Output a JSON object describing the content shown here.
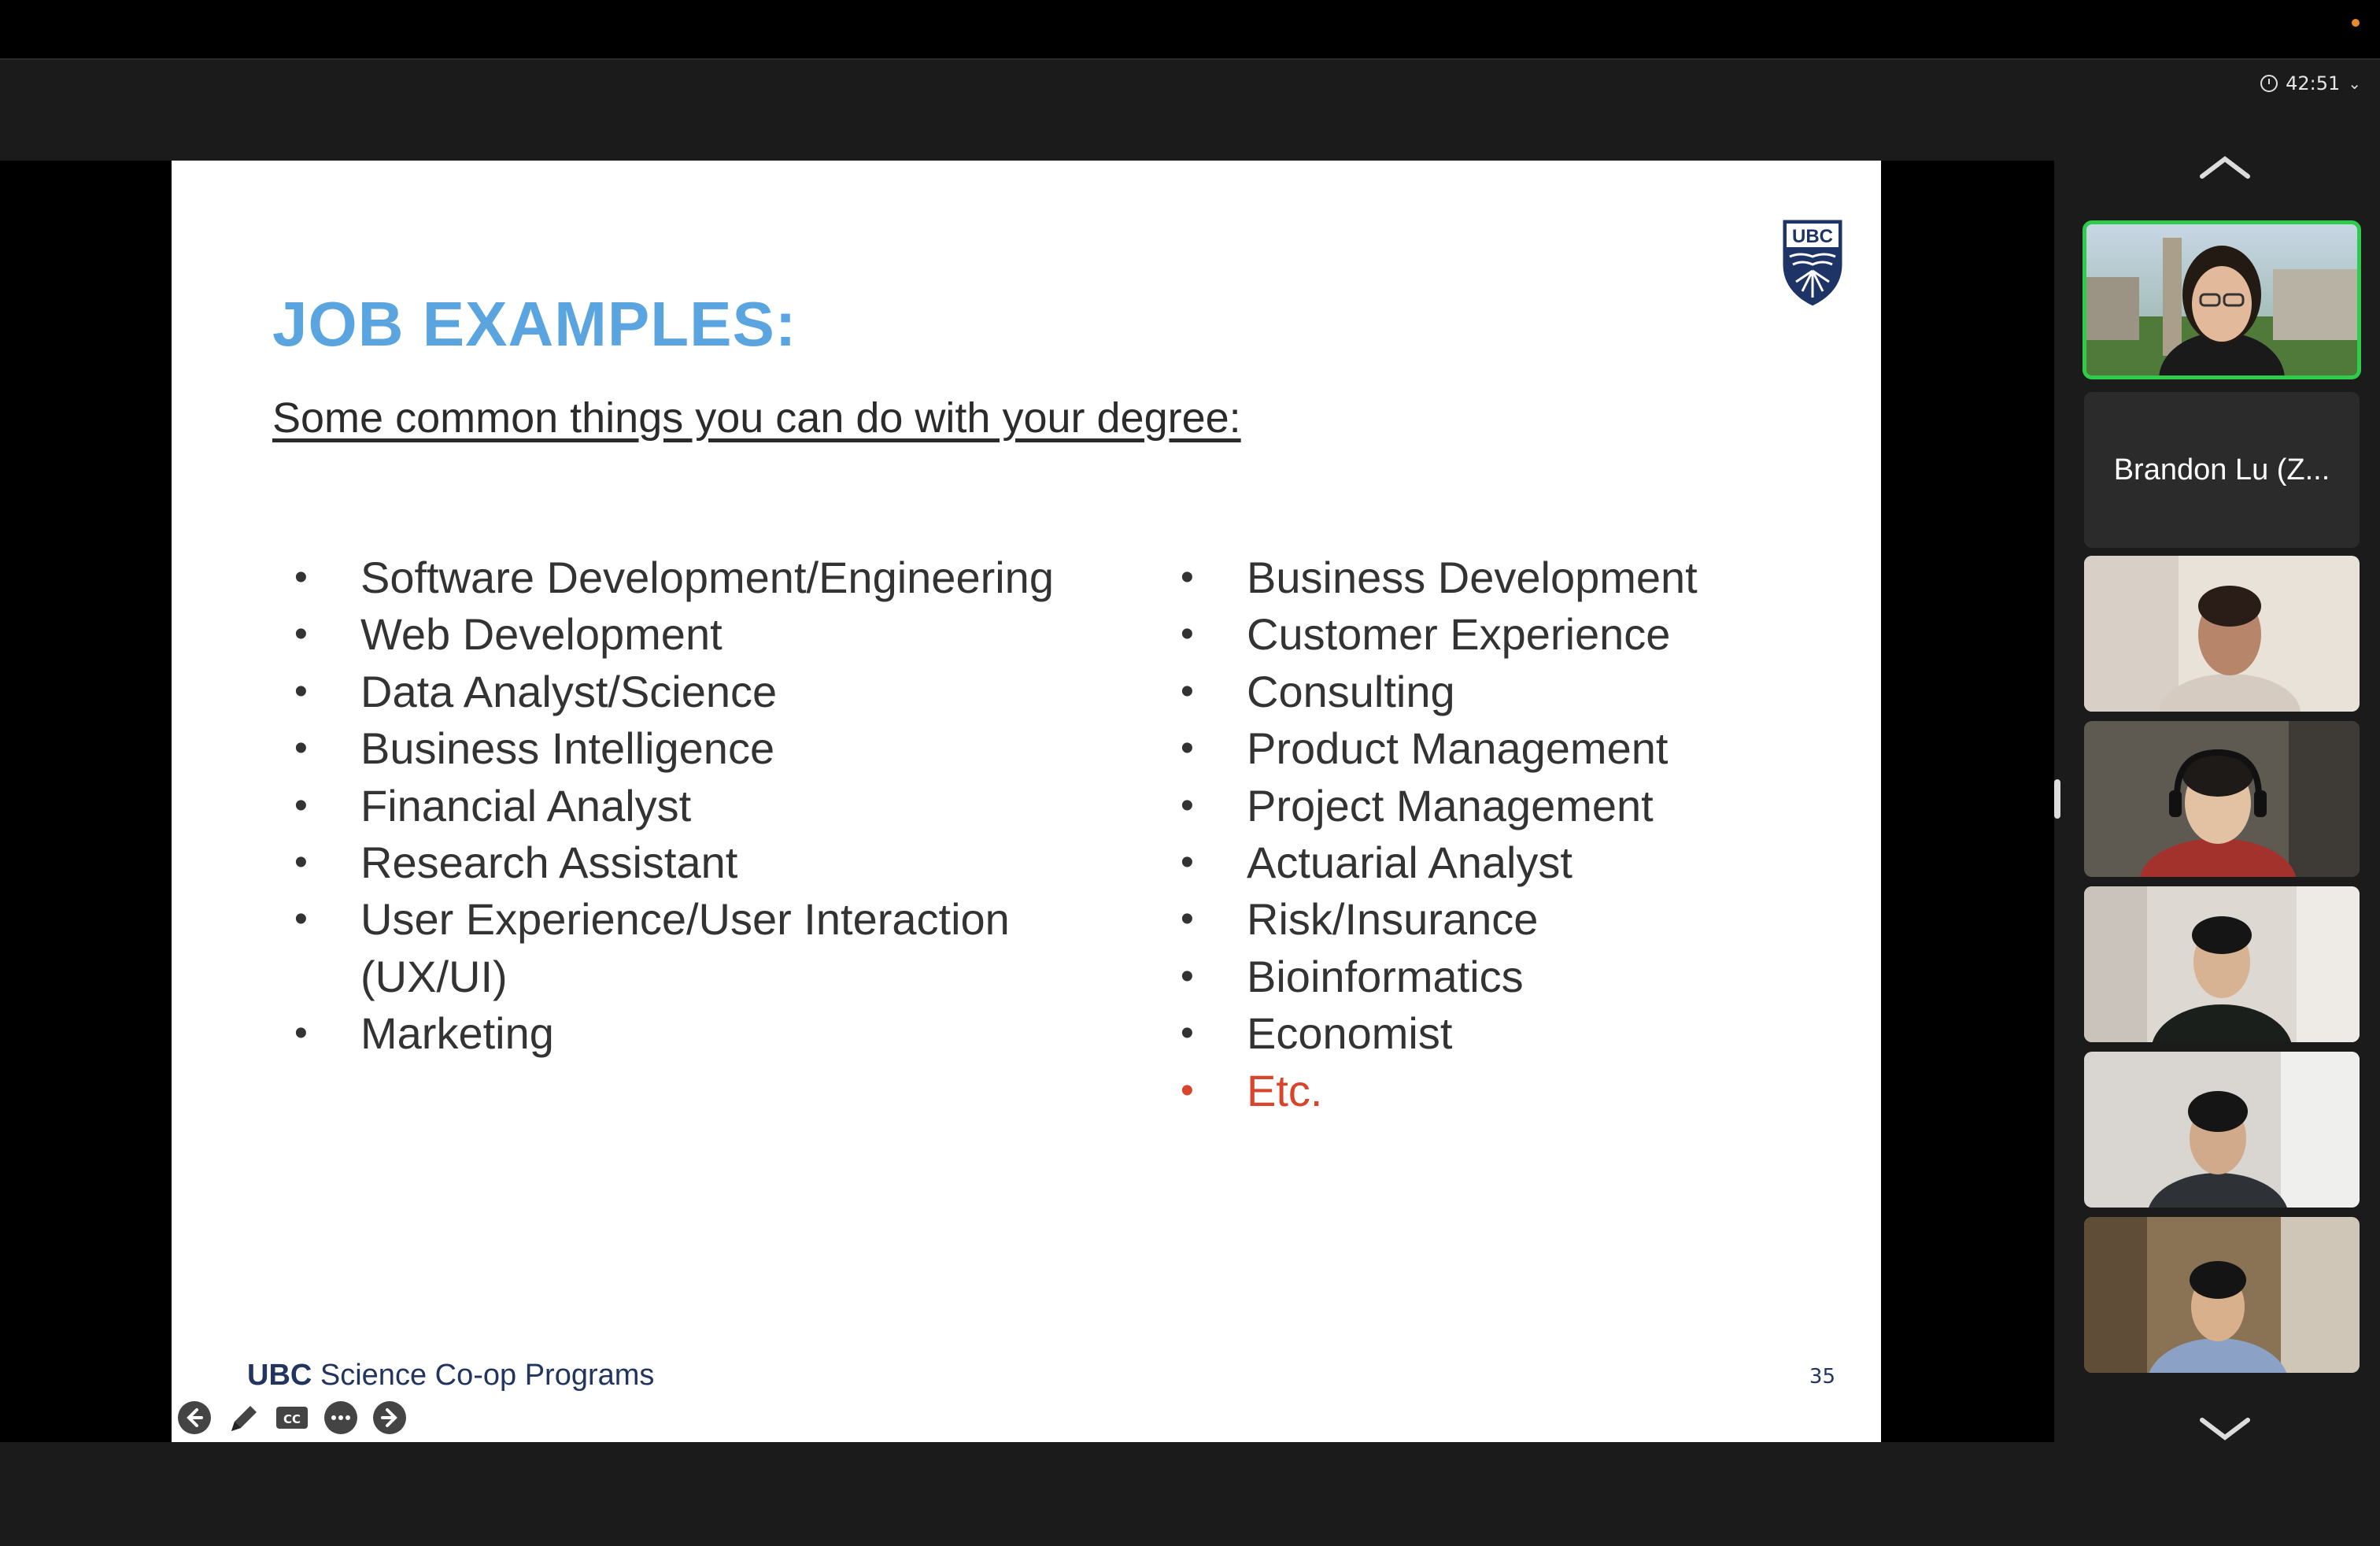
{
  "meeting": {
    "timer": "42:51"
  },
  "slide": {
    "title": "JOB EXAMPLES:",
    "subtitle": "Some common things you can do with your degree:",
    "left_items": [
      "Software Development/Engineering",
      "Web Development",
      "Data Analyst/Science",
      "Business Intelligence",
      "Financial Analyst",
      "Research Assistant",
      "User Experience/User Interaction",
      "(UX/UI)",
      "Marketing"
    ],
    "right_items": [
      "Business Development",
      "Customer Experience",
      "Consulting",
      "Product Management",
      "Project Management",
      "Actuarial Analyst",
      "Risk/Insurance",
      "Bioinformatics",
      "Economist",
      "Etc."
    ],
    "logo_text": "UBC",
    "footer_bold": "UBC",
    "footer_text": " Science Co-op Programs",
    "page_number": "35",
    "accent_color": "#5aa4e0",
    "etc_color": "#d8452d"
  },
  "slide_controls": [
    "arrow-left-icon",
    "pen-icon",
    "cc-icon",
    "more-icon",
    "arrow-right-icon"
  ],
  "participants": {
    "name_tile": "Brandon Lu (Z...",
    "active_color": "#2ecc4a"
  }
}
